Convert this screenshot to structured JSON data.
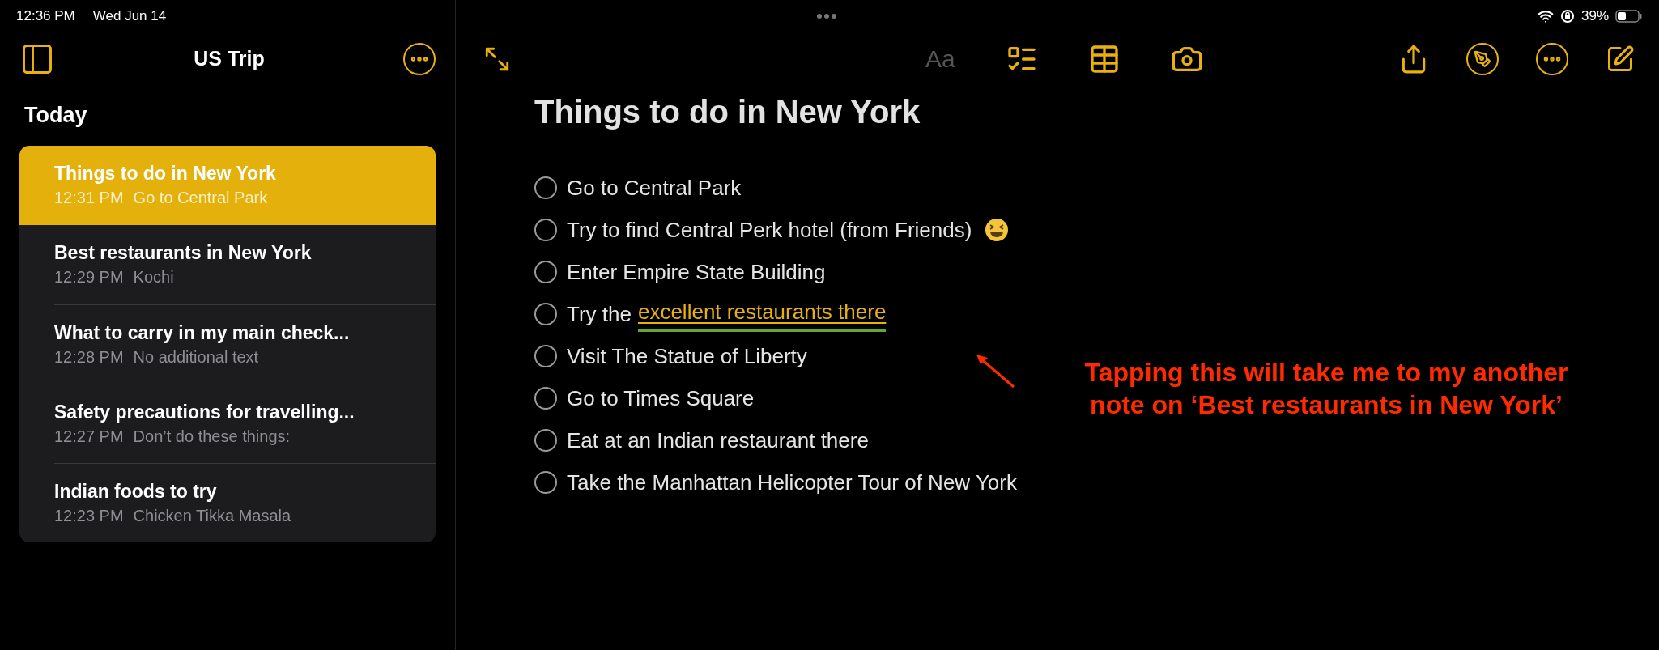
{
  "status_bar": {
    "time": "12:36 PM",
    "date": "Wed Jun 14",
    "battery": "39%"
  },
  "sidebar": {
    "folder_title": "US Trip",
    "section": "Today",
    "notes": [
      {
        "title": "Things to do in New York",
        "time": "12:31 PM",
        "preview": "Go to Central Park",
        "selected": true
      },
      {
        "title": "Best restaurants in New York",
        "time": "12:29 PM",
        "preview": "Kochi",
        "selected": false
      },
      {
        "title": "What to carry in my main check...",
        "time": "12:28 PM",
        "preview": "No additional text",
        "selected": false
      },
      {
        "title": "Safety precautions for travelling...",
        "time": "12:27 PM",
        "preview": "Don’t do these things:",
        "selected": false
      },
      {
        "title": "Indian foods to try",
        "time": "12:23 PM",
        "preview": "Chicken Tikka Masala",
        "selected": false
      }
    ]
  },
  "toolbar": {
    "format_button": {
      "label": "Aa",
      "disabled": true
    }
  },
  "note": {
    "title": "Things to do in New York",
    "items": [
      {
        "kind": "plain",
        "text": "Go to Central Park",
        "checked": false
      },
      {
        "kind": "emoji",
        "text": "Try to find Central Perk hotel (from Friends)",
        "checked": false
      },
      {
        "kind": "plain",
        "text": "Enter Empire State Building",
        "checked": false
      },
      {
        "kind": "link",
        "text": "Try the",
        "link": "excellent restaurants there",
        "checked": false
      },
      {
        "kind": "plain",
        "text": "Visit The Statue of Liberty",
        "checked": false
      },
      {
        "kind": "plain",
        "text": "Go to Times Square",
        "checked": false
      },
      {
        "kind": "plain",
        "text": "Eat at an Indian restaurant there",
        "checked": false
      },
      {
        "kind": "plain",
        "text": "Take the Manhattan Helicopter Tour of New York",
        "checked": false
      }
    ]
  },
  "annotation": {
    "lines": [
      "Tapping this will take me to my another",
      "note on ‘Best restaurants in New York’"
    ]
  }
}
